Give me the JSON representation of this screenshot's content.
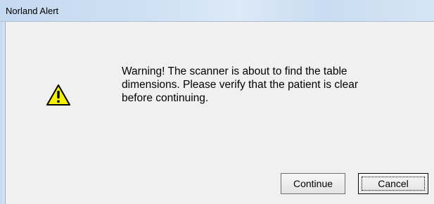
{
  "window": {
    "title": "Norland Alert"
  },
  "alert": {
    "icon": "warning-icon",
    "message_lines": [
      "Warning!  The scanner is about to find the table",
      "dimensions.  Please verify that the patient is clear",
      "before continuing."
    ]
  },
  "buttons": {
    "continue_label": "Continue",
    "cancel_label": "Cancel"
  },
  "colors": {
    "warning_fill": "#f5f000",
    "titlebar": "#cfe1f4"
  }
}
